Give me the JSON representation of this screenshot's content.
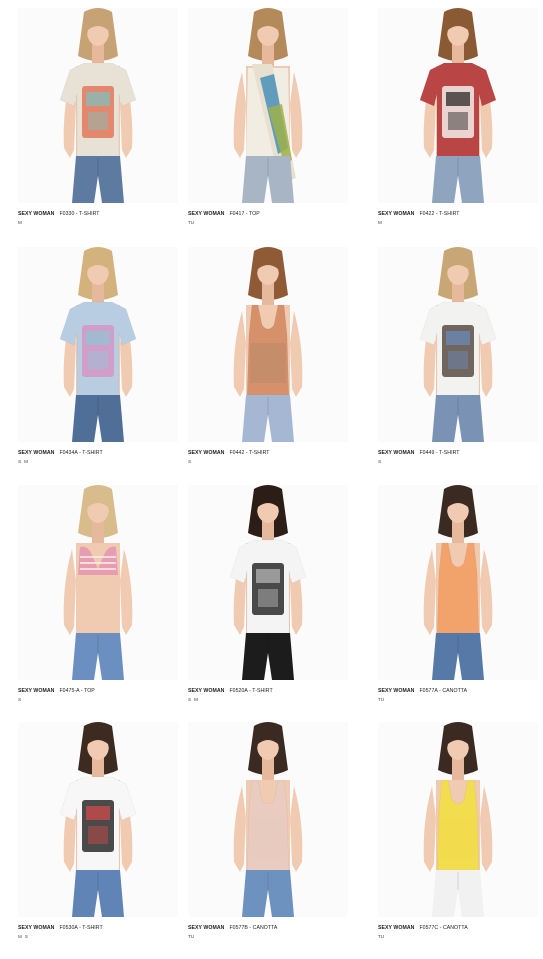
{
  "products": [
    {
      "brand": "SEXY WOMAN",
      "code": "F0330 - T-SHIRT",
      "sizes": [
        "M"
      ],
      "colors": {
        "top": "#e7e1d6",
        "print": "#e2785a",
        "print2": "#7cc3c0",
        "pants": "#5d7aa0",
        "hair": "#c7a274"
      }
    },
    {
      "brand": "SEXY WOMAN",
      "code": "F0417 - TOP",
      "sizes": [
        "TU"
      ],
      "colors": {
        "top": "#e8e0cf",
        "print": "#3f8bb6",
        "print2": "#9fb24a",
        "pants": "#a8b5c4",
        "hair": "#b48a5a"
      }
    },
    {
      "brand": "SEXY WOMAN",
      "code": "F0422 - T-SHIRT",
      "sizes": [
        "M"
      ],
      "colors": {
        "top": "#b94545",
        "print": "#f2ecea",
        "print2": "#1d1d1d",
        "pants": "#8ea4bf",
        "hair": "#8a5a35"
      }
    },
    {
      "brand": "SEXY WOMAN",
      "code": "F0434A - T-SHIRT",
      "sizes": [
        "S",
        "M"
      ],
      "colors": {
        "top": "#b9cde2",
        "print": "#d595c5",
        "print2": "#8ec5d6",
        "pants": "#4f6f98",
        "hair": "#d4b27d"
      }
    },
    {
      "brand": "SEXY WOMAN",
      "code": "F0442 - T-SHIRT",
      "sizes": [
        "S"
      ],
      "colors": {
        "top": "#d6906a",
        "print": "#93836d",
        "print2": "#b9734f",
        "pants": "#a6b7d4",
        "hair": "#8f5a36"
      }
    },
    {
      "brand": "SEXY WOMAN",
      "code": "F0449 - T-SHIRT",
      "sizes": [
        "S"
      ],
      "colors": {
        "top": "#f2f2f0",
        "print": "#5b4d43",
        "print2": "#6b8cc0",
        "pants": "#7a93b4",
        "hair": "#c9a676"
      }
    },
    {
      "brand": "SEXY WOMAN",
      "code": "F0475-A - TOP",
      "sizes": [
        "S"
      ],
      "colors": {
        "top": "#e89cb1",
        "print": "#f5f1ee",
        "print2": "#e58aa5",
        "pants": "#6b8fc0",
        "hair": "#d8bc8b"
      }
    },
    {
      "brand": "SEXY WOMAN",
      "code": "F0520A - T-SHIRT",
      "sizes": [
        "S",
        "M"
      ],
      "colors": {
        "top": "#f4f4f4",
        "print": "#2a2a2a",
        "print2": "#bdbdbd",
        "pants": "#1c1c1c",
        "hair": "#2c1d17"
      }
    },
    {
      "brand": "SEXY WOMAN",
      "code": "F0577A - CANOTTA",
      "sizes": [
        "TU"
      ],
      "colors": {
        "top": "#f2a26b",
        "print": "#f2a26b",
        "print2": "#f2a26b",
        "pants": "#5779a7",
        "hair": "#3a2a22"
      }
    },
    {
      "brand": "SEXY WOMAN",
      "code": "F0530A - T-SHIRT",
      "sizes": [
        "M",
        "S"
      ],
      "colors": {
        "top": "#f7f7f7",
        "print": "#2b2b2b",
        "print2": "#d94a4a",
        "pants": "#5f84b5",
        "hair": "#3d2b21"
      }
    },
    {
      "brand": "SEXY WOMAN",
      "code": "F0577B - CANOTTA",
      "sizes": [
        "TU"
      ],
      "colors": {
        "top": "#e9cbbf",
        "print": "#e9cbbf",
        "print2": "#e9cbbf",
        "pants": "#6e92bf",
        "hair": "#3b2a22"
      }
    },
    {
      "brand": "SEXY WOMAN",
      "code": "F0577C - CANOTTA",
      "sizes": [
        "TU"
      ],
      "colors": {
        "top": "#f2dd4e",
        "print": "#f2dd4e",
        "print2": "#f2dd4e",
        "pants": "#f3f3f3",
        "hair": "#3a2a22"
      }
    }
  ]
}
